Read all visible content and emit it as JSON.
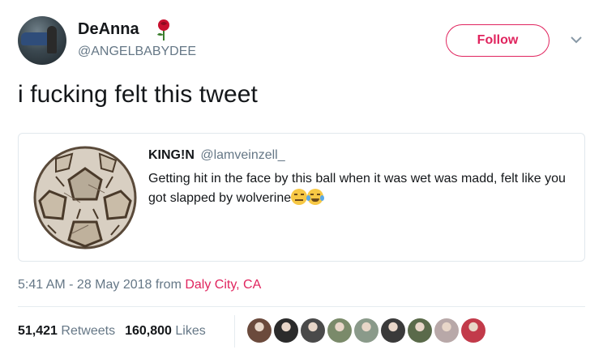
{
  "author": {
    "display_name": "DeAnna",
    "handle": "@ANGELBABYDEE",
    "name_emoji": "rose-icon"
  },
  "actions": {
    "follow_label": "Follow",
    "more_icon": "chevron-down-icon"
  },
  "tweet": {
    "text": "i fucking felt this tweet"
  },
  "quote": {
    "author_name": "KING!N",
    "author_handle": "@lamveinzell_",
    "text": "Getting hit in the face by this ball when it was wet was madd, felt like you got slapped by wolverine",
    "emojis": [
      "sleeping-face-icon",
      "tears-of-joy-icon"
    ],
    "media": "cracked-soccer-ball-image"
  },
  "meta": {
    "time_date": "5:41 AM - 28 May 2018",
    "from_label": "from",
    "location": "Daly City, CA"
  },
  "stats": {
    "retweets_count": "51,421",
    "retweets_label": "Retweets",
    "likes_count": "160,800",
    "likes_label": "Likes"
  },
  "likers": [
    {
      "name": "liker-avatar",
      "color": "#6b4a3c"
    },
    {
      "name": "liker-avatar",
      "color": "#2b2b2b"
    },
    {
      "name": "liker-avatar",
      "color": "#4a4a4a"
    },
    {
      "name": "liker-avatar",
      "color": "#7a8a6a"
    },
    {
      "name": "liker-avatar",
      "color": "#8a9a8a"
    },
    {
      "name": "liker-avatar",
      "color": "#3a3a3a"
    },
    {
      "name": "liker-avatar",
      "color": "#5a6a4a"
    },
    {
      "name": "liker-avatar",
      "color": "#b8a8a8"
    },
    {
      "name": "liker-avatar",
      "color": "#c23a4a"
    }
  ],
  "colors": {
    "accent": "#e0245e",
    "text": "#14171a",
    "muted": "#657786",
    "border": "#e1e8ed"
  }
}
